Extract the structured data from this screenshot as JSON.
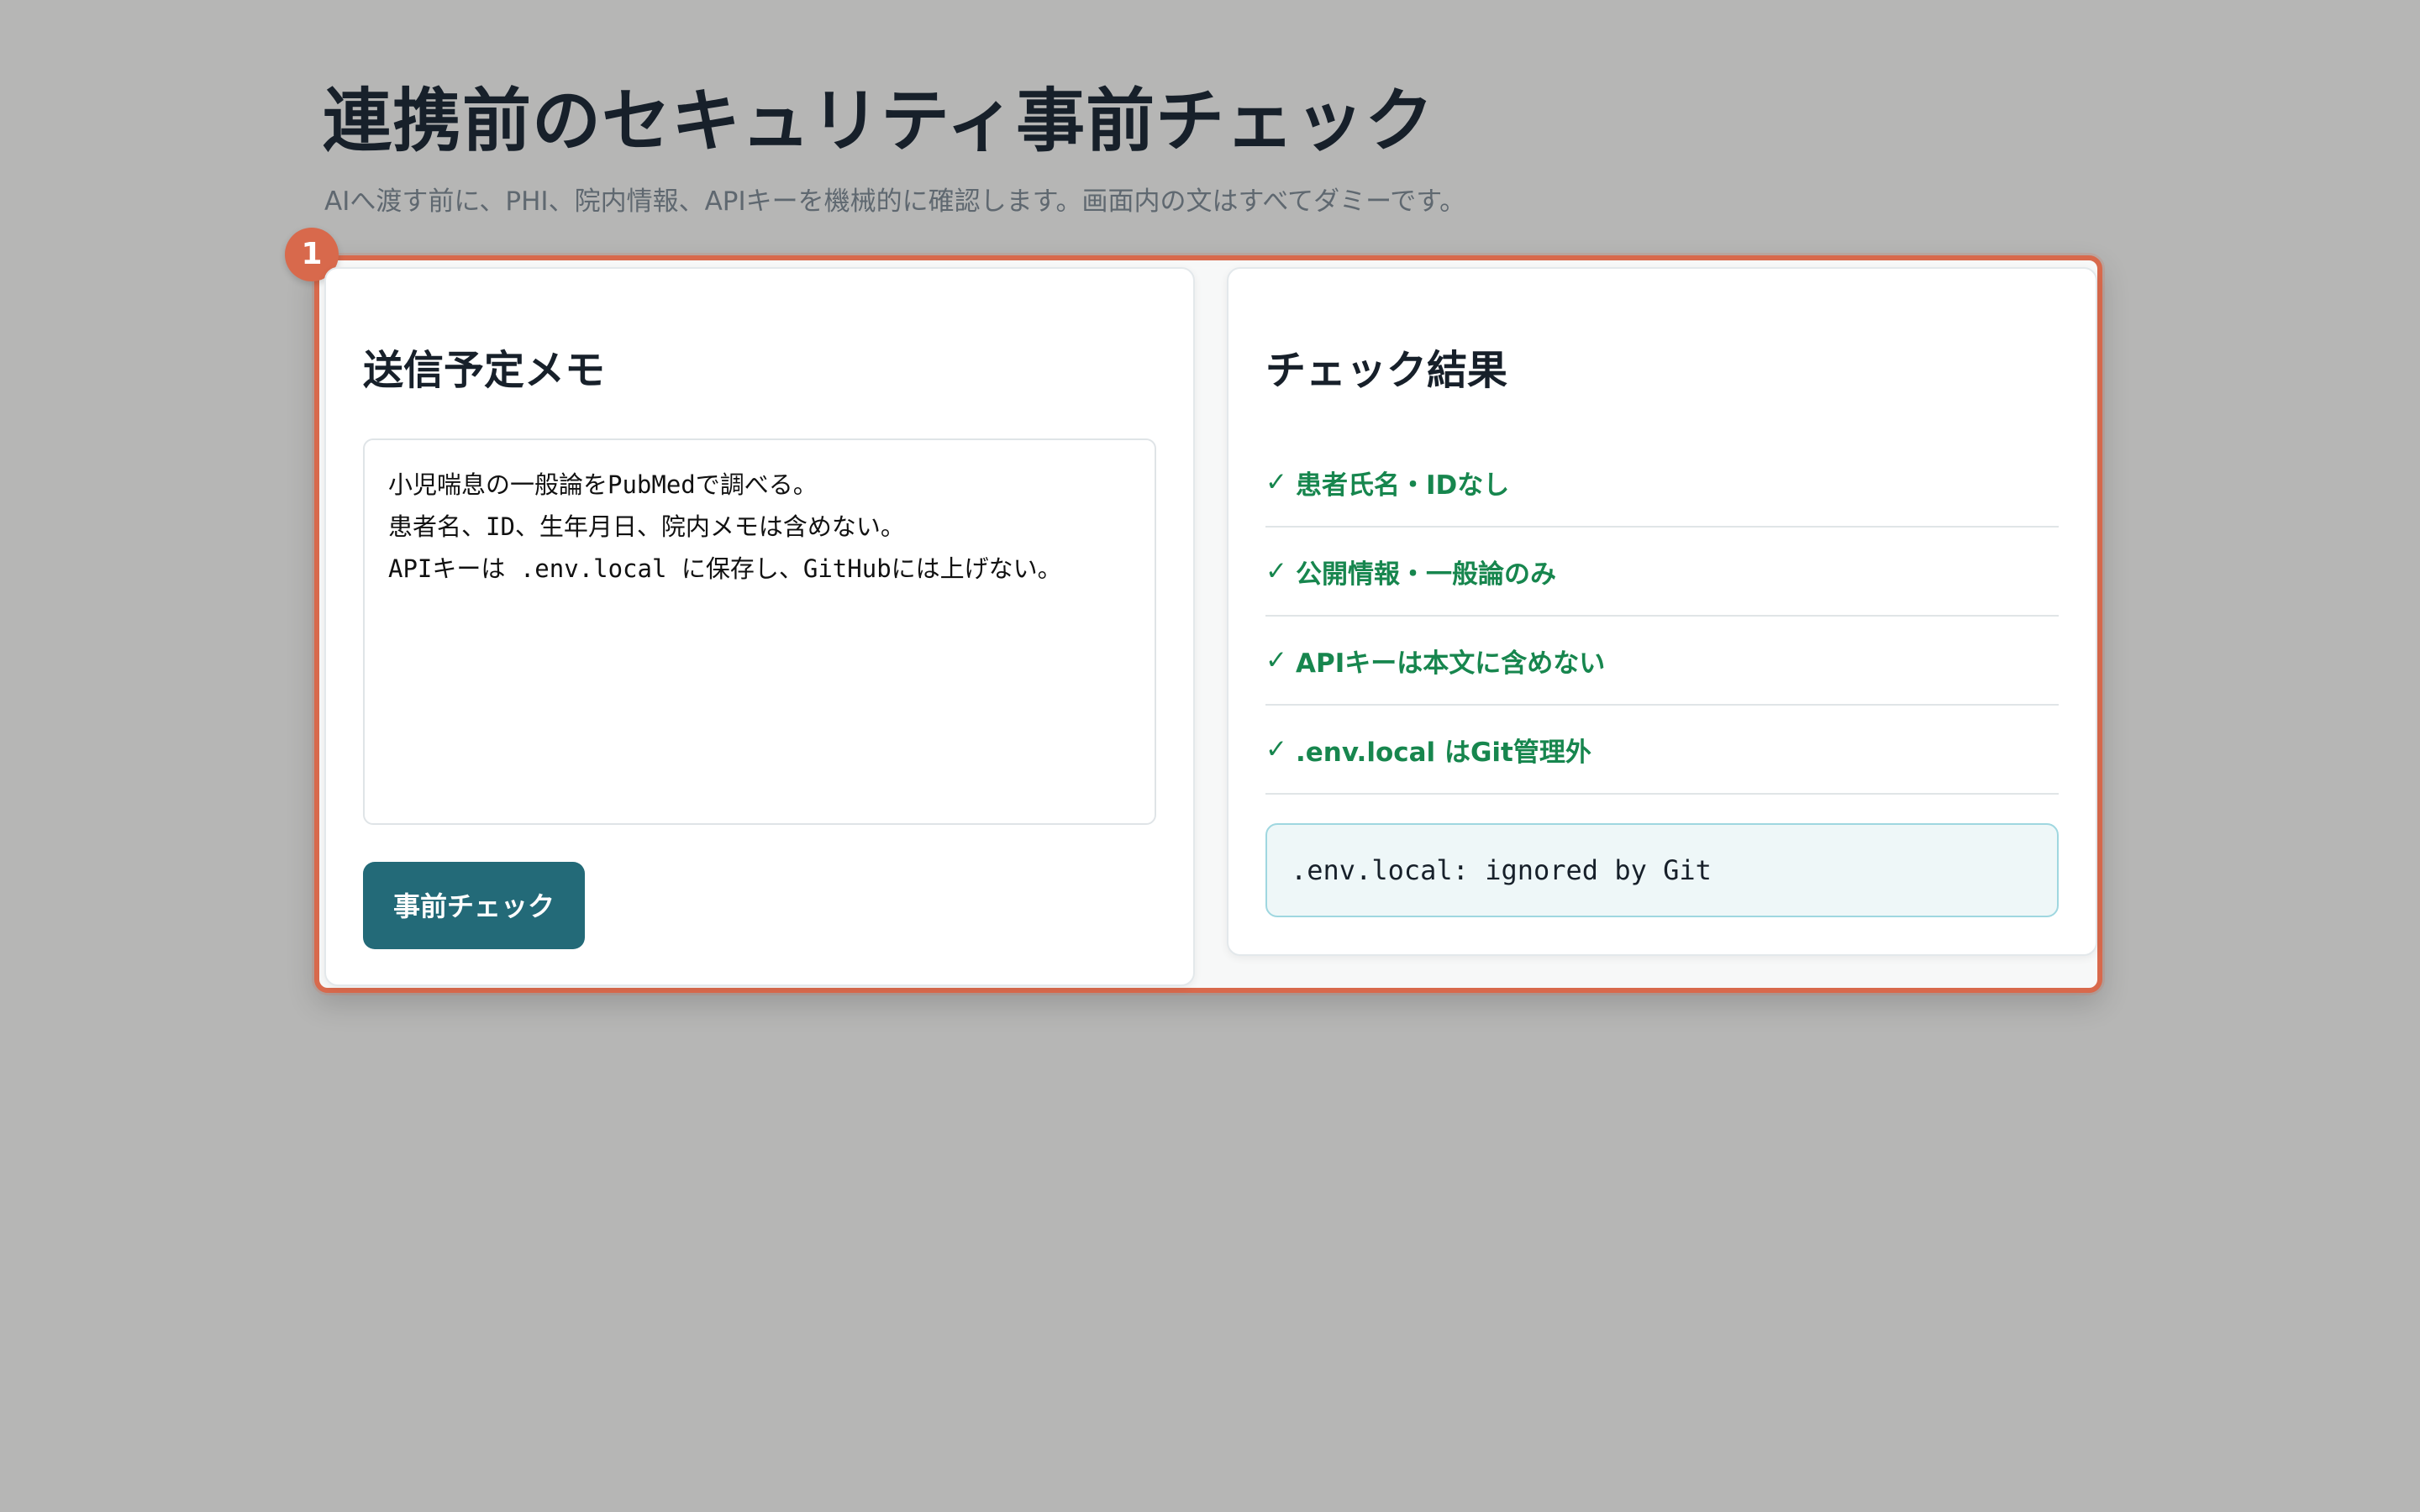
{
  "header": {
    "title": "連携前のセキュリティ事前チェック",
    "subtitle": "AIへ渡す前に、PHI、院内情報、APIキーを機械的に確認します。画面内の文はすべてダミーです。"
  },
  "highlight": {
    "step": "1",
    "accent_color": "#d8694c"
  },
  "memo": {
    "title": "送信予定メモ",
    "text": "小児喘息の一般論をPubMedで調べる。\n患者名、ID、生年月日、院内メモは含めない。\nAPIキーは .env.local に保存し、GitHubには上げない。",
    "button_label": "事前チェック",
    "button_color": "#236a78"
  },
  "results": {
    "title": "チェック結果",
    "items": [
      {
        "icon": "check-icon",
        "mark": "✓",
        "label": "患者氏名・IDなし"
      },
      {
        "icon": "check-icon",
        "mark": "✓",
        "label": "公開情報・一般論のみ"
      },
      {
        "icon": "check-icon",
        "mark": "✓",
        "label": "APIキーは本文に含めない"
      },
      {
        "icon": "check-icon",
        "mark": "✓",
        "label": ".env.local はGit管理外"
      }
    ],
    "status": ".env.local: ignored by Git",
    "success_color": "#17864e"
  }
}
